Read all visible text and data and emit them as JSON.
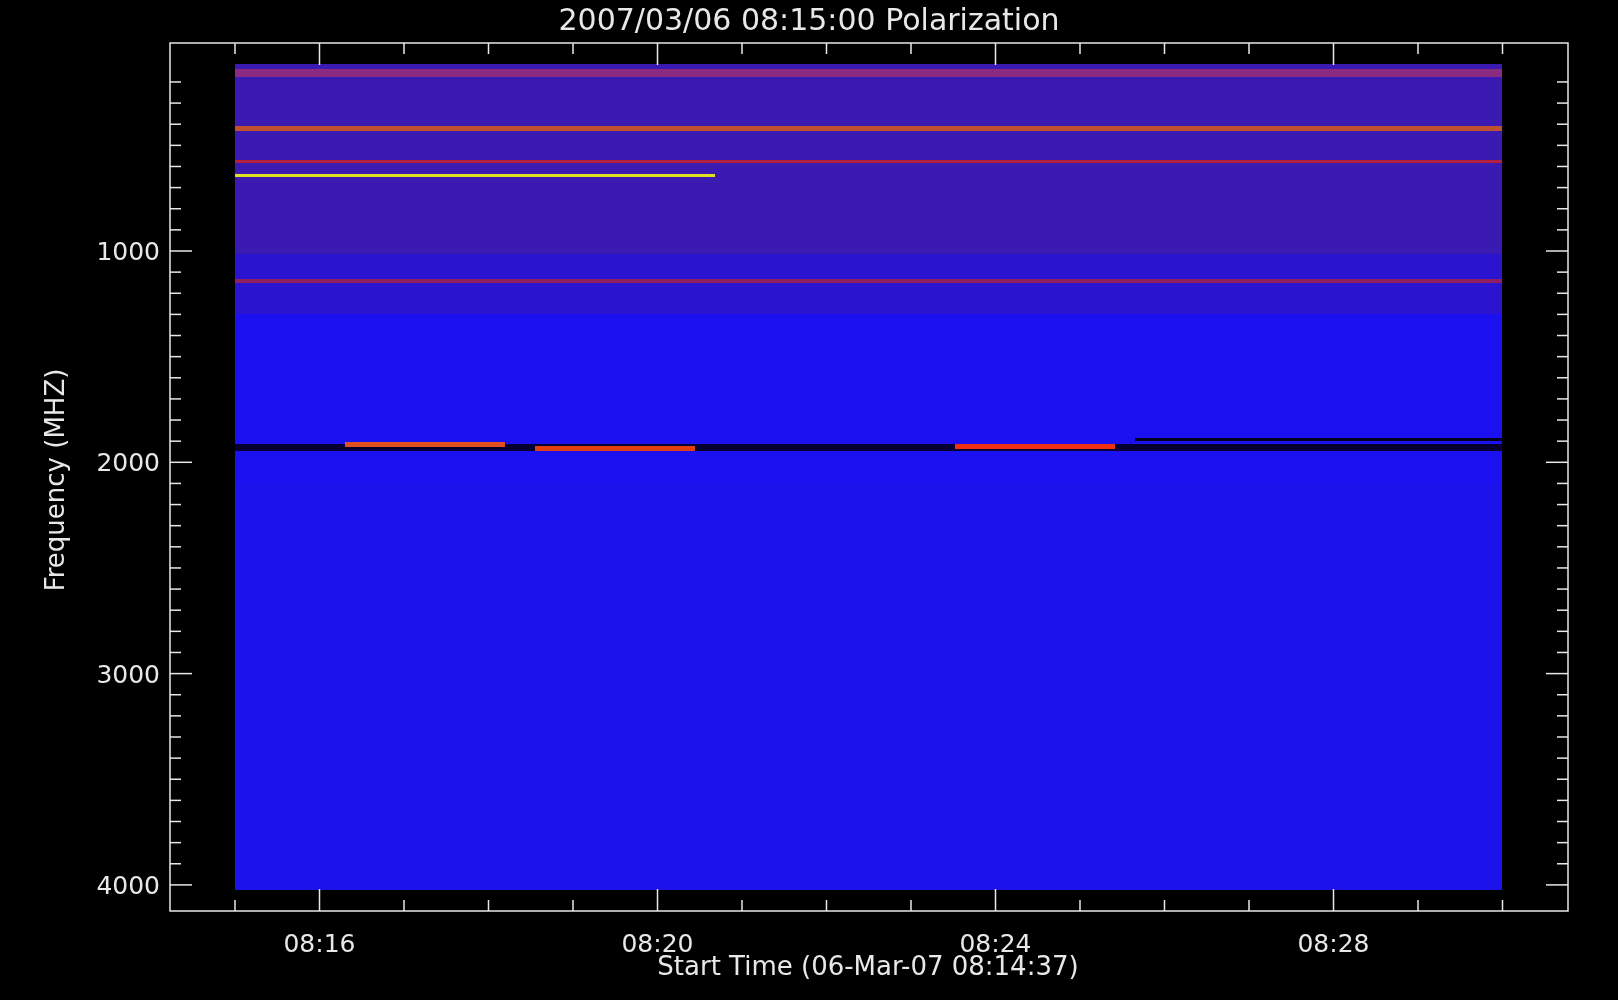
{
  "title": "2007/03/06 08:15:00 Polarization",
  "y_axis": {
    "label": "Frequency (MHZ)",
    "ticks": [
      "1000",
      "2000",
      "3000",
      "4000"
    ]
  },
  "x_axis": {
    "label": "Start Time (06-Mar-07 08:14:37)",
    "ticks": [
      "08:16",
      "08:20",
      "08:24",
      "08:28"
    ]
  }
}
